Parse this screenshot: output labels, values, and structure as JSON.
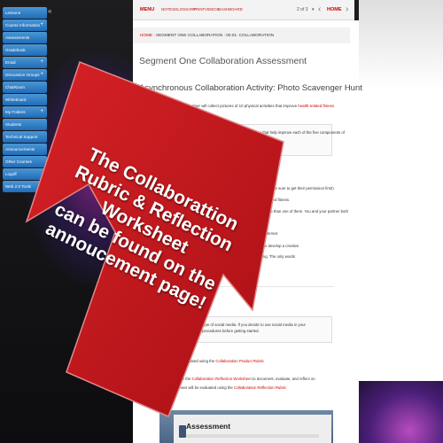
{
  "sidebar": {
    "items": [
      {
        "label": "Lessons",
        "plus": ""
      },
      {
        "label": "Course Information",
        "plus": "+"
      },
      {
        "label": "Assessments",
        "plus": ""
      },
      {
        "label": "Gradebook",
        "plus": ""
      },
      {
        "label": "Email",
        "plus": "+"
      },
      {
        "label": "Discussion Groups",
        "plus": "+"
      },
      {
        "label": "ChatRoom",
        "plus": ""
      },
      {
        "label": "Whiteboard",
        "plus": ""
      },
      {
        "label": "My Folders",
        "plus": "+"
      },
      {
        "label": "Students",
        "plus": ""
      },
      {
        "label": "Technical Support",
        "plus": ""
      },
      {
        "label": "Announcements",
        "plus": ""
      },
      {
        "label": "Other Courses",
        "plus": ""
      },
      {
        "label": "Logoff",
        "plus": ""
      },
      {
        "label": "Web 2.0 Tools",
        "plus": ""
      }
    ],
    "toggle": "«"
  },
  "topnav": {
    "menu": "MENU",
    "links": [
      "NOTES",
      "GLOSSARY",
      "PRINT",
      "VIDEOS",
      "DASHBOARD"
    ],
    "page": "2 of 3",
    "down": "▾",
    "prev": "‹",
    "home": "HOME",
    "next": "›"
  },
  "breadcrumb": {
    "home": "HOME",
    "rest": " : SEGMENT ONE COLLABORATION : 00.01: COLLABORATION"
  },
  "page": {
    "title": "Segment One Collaboration Assessment",
    "activity_title": "Asynchronous Collaboration Activity: Photo Scavenger Hunt",
    "intro_text": "In this activity, you and your partner will collect pictures of 10 physical activities that improve ",
    "intro_link": "health-related fitness",
    "box1_line1": "Review the lessons in Module One for examples of physical activities that help improve each of the five components of",
    "box1_line2": "health-related fitness.",
    "line_a": "Take pictures of someone performing the activities you have identified. (Just make sure to get their permission first!)",
    "line_b": "You should take at least two activities that meet each component of health-related fitness.",
    "line_c": "If an activity meets more than one component, even if they might relate to more than one of them. You and your partner both",
    "line_d": "Use only your own snapshots and not images you have collected from the internet.",
    "line_e": "Then email them to your partner. You should communicate back and forth to develop a creative",
    "line_f": "You will need to be wordy in your presentation, let the pictures do the talking. The only words",
    "line_g": "component it addresses",
    "box2_line1": "You may use photographs or any type of social media. If you decide to use social media in your",
    "box2_line2": "presentation, follow the rules and procedures before getting started.",
    "rubric1_text": "Your presentation will be evaluated using the ",
    "rubric1_link": "Collaboration Product Rubric",
    "rubric2_text": "After the collaboration, use the ",
    "rubric2_link": "Collaboration Reflection Worksheet",
    "rubric2_after": " to document, evaluate, and reflect on",
    "rubric3_text": "the process. Your responses will be evaluated using the ",
    "rubric3_link": "Collaboration Reflection Rubric"
  },
  "assessment": {
    "label": "Assessment"
  },
  "callout": {
    "lines": [
      "The Collaborattion",
      "Rubric & Reflection",
      "Worksheet",
      "can be found on the",
      "annoucement page!"
    ]
  },
  "colors": {
    "arrow_red": "#c8171c",
    "sidebar_blue": "#2a78c2",
    "link_red": "#cc0000"
  }
}
